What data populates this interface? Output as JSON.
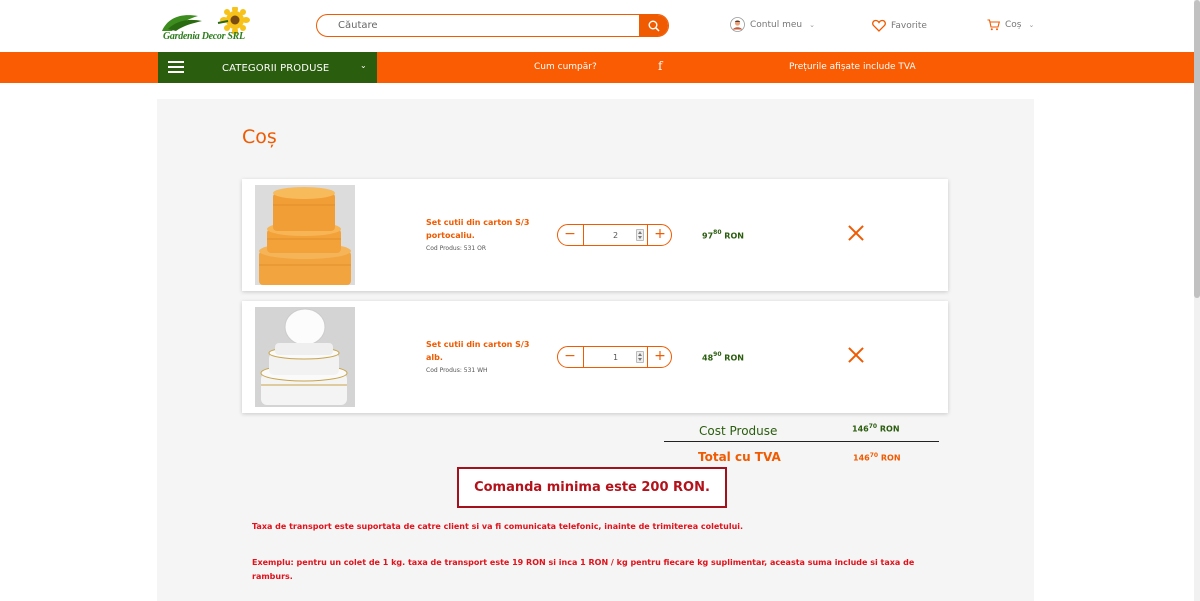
{
  "header": {
    "logo_text": "Gardenia Decor SRL",
    "search_placeholder": "Căutare",
    "account_label": "Contul meu",
    "favorites_label": "Favorite",
    "cart_label": "Coș"
  },
  "nav": {
    "categories_label": "CATEGORII PRODUSE",
    "how_to_buy": "Cum cumpăr?",
    "vat_note": "Prețurile afișate include TVA"
  },
  "cart": {
    "title": "Coș",
    "items": [
      {
        "name": "Set cutii din carton S/3 portocaliu.",
        "code": "Cod Produs: 531 OR",
        "quantity": "2",
        "price_int": "97",
        "price_dec": "80",
        "currency": "RON"
      },
      {
        "name": "Set cutii din carton S/3 alb.",
        "code": "Cod Produs: 531 WH",
        "quantity": "1",
        "price_int": "48",
        "price_dec": "90",
        "currency": "RON"
      }
    ],
    "summary": {
      "products_label": "Cost Produse",
      "products_int": "146",
      "products_dec": "70",
      "total_label": "Total cu TVA",
      "total_int": "146",
      "total_dec": "70",
      "currency": "RON"
    },
    "min_order": "Comanda minima este 200 RON.",
    "note_transport": "Taxa de transport este suportata de catre client si va fi comunicata telefonic, inainte de trimiterea coletului.",
    "note_example": "Exemplu: pentru un colet de 1 kg. taxa de transport este 19 RON si inca 1 RON / kg pentru fiecare kg suplimentar, aceasta suma include si taxa de ramburs."
  },
  "colors": {
    "orange": "#f95c02",
    "green": "#2a5d0e",
    "red": "#e0121b"
  },
  "icons": [
    "logo-sunflower-icon",
    "search-icon",
    "user-icon",
    "heart-icon",
    "cart-icon",
    "menu-icon",
    "facebook-icon",
    "minus-icon",
    "plus-icon",
    "close-icon"
  ]
}
